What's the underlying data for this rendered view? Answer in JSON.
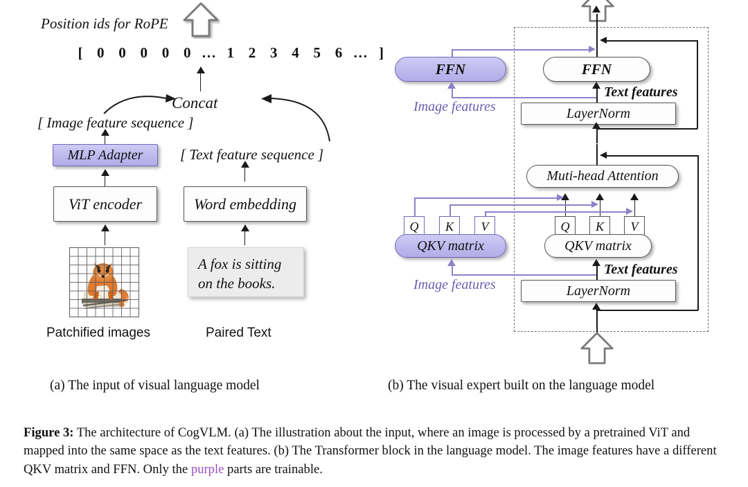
{
  "figure": {
    "number": "Figure 3:",
    "caption_part1": " The architecture of CogVLM. (a) The illustration about the input, where an image is processed by a pretrained ViT and mapped into the same space as the text features. (b) The Transformer block in the language model. The image features have a different QKV matrix and FFN. Only the ",
    "purple_word": "purple",
    "caption_part2": " parts are trainable."
  },
  "panel_a": {
    "subcaption": "(a) The input of visual language model",
    "position_ids_label": "Position ids for RoPE",
    "position_ids_sequence": [
      "[",
      "0",
      "0",
      "0",
      "0",
      "0",
      "…",
      "1",
      "2",
      "3",
      "4",
      "5",
      "6",
      "…",
      "]"
    ],
    "concat_label": "Concat",
    "image_feature_sequence": "[ Image feature sequence ]",
    "text_feature_sequence": "[ Text  feature sequence ]",
    "mlp_adapter": "MLP Adapter",
    "vit_encoder": "ViT encoder",
    "word_embedding": "Word embedding",
    "sample_text_line1": "A fox is sitting",
    "sample_text_line2": "on the books.",
    "patchified_images_label": "Patchified images",
    "paired_text_label": "Paired Text"
  },
  "panel_b": {
    "subcaption": "(b) The visual expert built on the language model",
    "ffn_image": "FFN",
    "ffn_text": "FFN",
    "layernorm_top": "LayerNorm",
    "layernorm_bottom": "LayerNorm",
    "attention": "Muti-head Attention",
    "qkv_image": "QKV matrix",
    "qkv_text": "QKV matrix",
    "q_label": "Q",
    "k_label": "K",
    "v_label": "V",
    "image_features_top": "Image features",
    "image_features_bottom": "Image features",
    "text_features_top": "Text features",
    "text_features_bottom": "Text features"
  },
  "colors": {
    "purple_fill": "#bdb7ec",
    "purple_border": "#6f68b8",
    "purple_arrow": "#8b82c9",
    "purple_text": "#6a5fb0",
    "caption_purple": "#9b4fc0",
    "box_border": "#555555",
    "dashed_border": "#6e6e6e"
  }
}
